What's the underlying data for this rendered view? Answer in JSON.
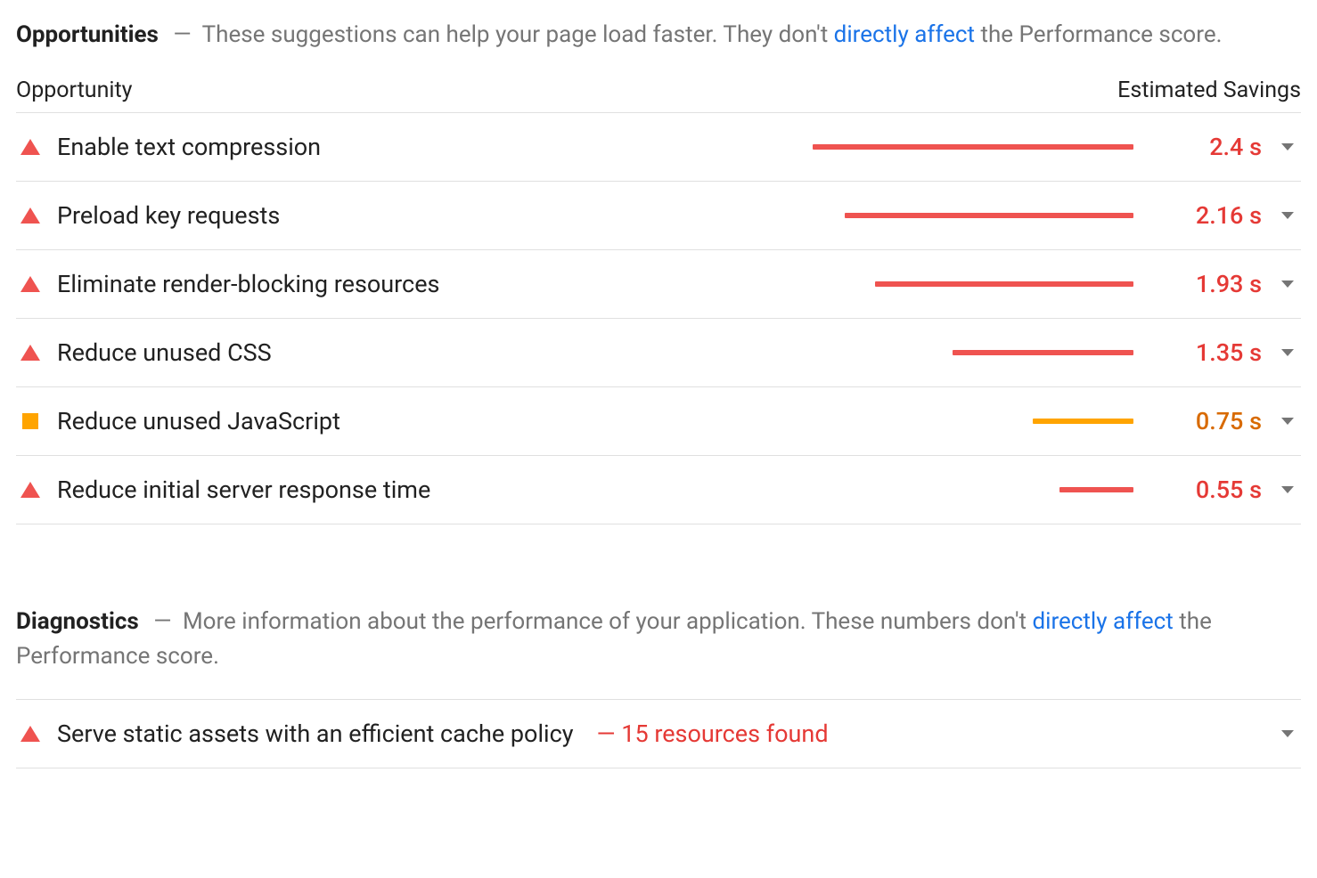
{
  "opportunities": {
    "title": "Opportunities",
    "dash": "—",
    "desc_before": "These suggestions can help your page load faster. They don't ",
    "desc_link": "directly affect",
    "desc_after": " the Performance score.",
    "column_opportunity": "Opportunity",
    "column_savings": "Estimated Savings",
    "bar_max": 2.4,
    "items": [
      {
        "severity": "red",
        "label": "Enable text compression",
        "savings_value": 2.4,
        "savings_text": "2.4 s",
        "bar_color": "red"
      },
      {
        "severity": "red",
        "label": "Preload key requests",
        "savings_value": 2.16,
        "savings_text": "2.16 s",
        "bar_color": "red"
      },
      {
        "severity": "red",
        "label": "Eliminate render-blocking resources",
        "savings_value": 1.93,
        "savings_text": "1.93 s",
        "bar_color": "red"
      },
      {
        "severity": "red",
        "label": "Reduce unused CSS",
        "savings_value": 1.35,
        "savings_text": "1.35 s",
        "bar_color": "red"
      },
      {
        "severity": "orange",
        "label": "Reduce unused JavaScript",
        "savings_value": 0.75,
        "savings_text": "0.75 s",
        "bar_color": "orange"
      },
      {
        "severity": "red",
        "label": "Reduce initial server response time",
        "savings_value": 0.55,
        "savings_text": "0.55 s",
        "bar_color": "red"
      }
    ]
  },
  "diagnostics": {
    "title": "Diagnostics",
    "dash": "—",
    "desc_before": "More information about the performance of your application. These numbers don't ",
    "desc_link": "directly affect",
    "desc_after": " the Performance score.",
    "items": [
      {
        "severity": "red",
        "label": "Serve static assets with an efficient cache policy",
        "detail_dash": "—",
        "detail": "15 resources found"
      }
    ]
  }
}
